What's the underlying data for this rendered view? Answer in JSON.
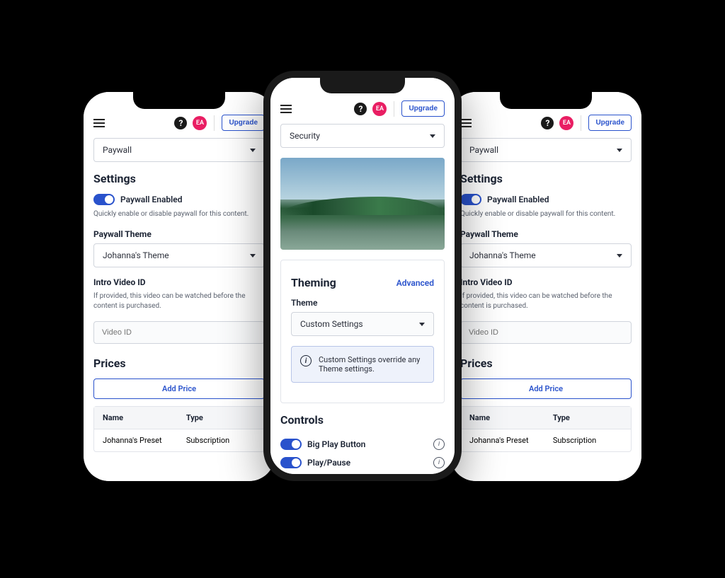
{
  "header": {
    "help_glyph": "?",
    "avatar_initials": "EA",
    "upgrade_label": "Upgrade"
  },
  "left_panel": {
    "picker_value": "Paywall",
    "settings_title": "Settings",
    "paywall_toggle_label": "Paywall Enabled",
    "paywall_desc": "Quickly enable or disable paywall for this content.",
    "theme_label": "Paywall Theme",
    "theme_value": "Johanna's Theme",
    "intro_label": "Intro Video ID",
    "intro_desc": "If provided, this video can be watched before the content is purchased.",
    "intro_placeholder": "Video ID",
    "prices_title": "Prices",
    "add_price_label": "Add Price",
    "col_name": "Name",
    "col_type": "Type",
    "row_name": "Johanna's Preset",
    "row_type": "Subscription"
  },
  "center_panel": {
    "picker_value": "Security",
    "theming_title": "Theming",
    "advanced_link": "Advanced",
    "theme_label": "Theme",
    "theme_value": "Custom Settings",
    "info_text": "Custom Settings override any Theme settings.",
    "controls_title": "Controls",
    "control_big_play": "Big Play Button",
    "control_play_pause": "Play/Pause"
  },
  "right_panel": {
    "picker_value": "Paywall",
    "settings_title": "Settings",
    "paywall_toggle_label": "Paywall Enabled",
    "paywall_desc": "Quickly enable or disable paywall for this content.",
    "theme_label": "Paywall Theme",
    "theme_value": "Johanna's Theme",
    "intro_label": "Intro Video ID",
    "intro_desc": "If provided, this video can be watched before the content is purchased.",
    "intro_placeholder": "Video ID",
    "prices_title": "Prices",
    "add_price_label": "Add Price",
    "col_name": "Name",
    "col_type": "Type",
    "row_name": "Johanna's Preset",
    "row_type": "Subscription"
  }
}
